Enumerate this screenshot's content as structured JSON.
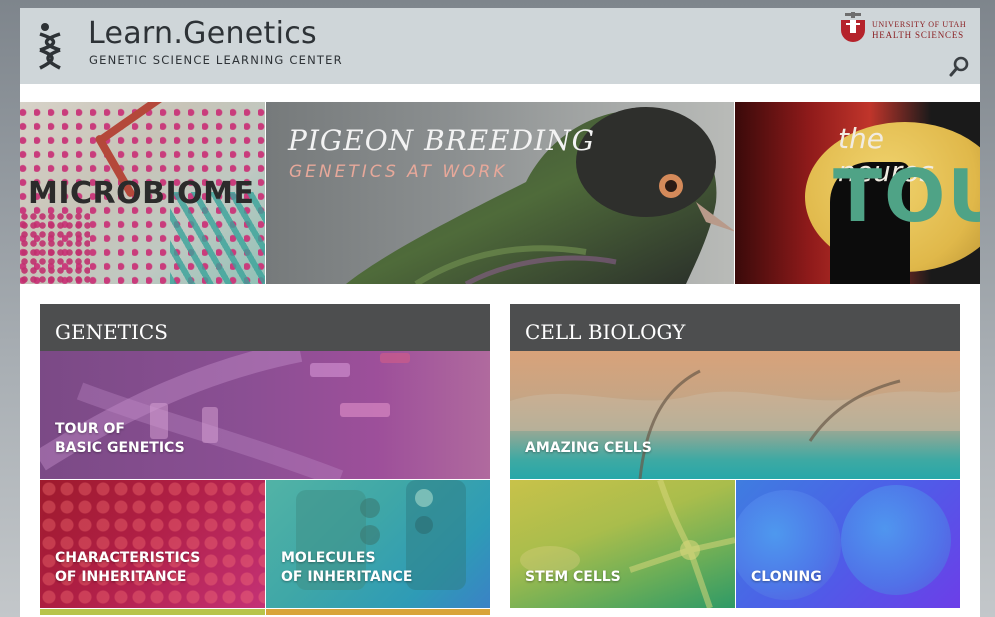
{
  "header": {
    "title": "Learn.Genetics",
    "subtitle": "GENETIC SCIENCE LEARNING CENTER",
    "university_line1": "UNIVERSITY OF UTAH",
    "university_line2": "HEALTH SCIENCES",
    "search_icon": "search-icon"
  },
  "banner": {
    "slides": [
      {
        "title": "MICROBIOME"
      },
      {
        "title": "PIGEON BREEDING",
        "subtitle": "GENETICS AT WORK"
      },
      {
        "title": "the neuros",
        "subtitle": "TOU"
      }
    ]
  },
  "sections": {
    "genetics": {
      "heading": "GENETICS",
      "tiles": [
        {
          "line1": "TOUR OF",
          "line2": "BASIC GENETICS"
        },
        {
          "line1": "CHARACTERISTICS",
          "line2": "OF INHERITANCE"
        },
        {
          "line1": "MOLECULES",
          "line2": "OF INHERITANCE"
        }
      ]
    },
    "cell_biology": {
      "heading": "CELL BIOLOGY",
      "tiles": [
        {
          "label": "AMAZING CELLS"
        },
        {
          "label": "STEM CELLS"
        },
        {
          "label": "CLONING"
        }
      ]
    }
  },
  "colors": {
    "header_bg": "#cfd6d9",
    "section_head_bg": "#4d4e4f",
    "brand_red": "#8a1f22"
  }
}
